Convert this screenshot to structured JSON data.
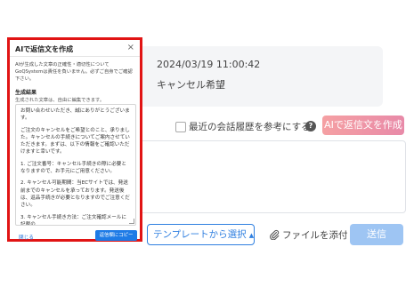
{
  "message": {
    "date": "2024/03/19 11:00:42",
    "text": "キャンセル希望"
  },
  "controls": {
    "history_checkbox_label": "最近の会話履歴を参考にする",
    "help_icon_glyph": "?",
    "ai_reply_button": "AIで返信文を作成"
  },
  "bottom_bar": {
    "template_button": "テンプレートから選択",
    "template_caret": "▲",
    "attach_label": "ファイルを添付",
    "send_button": "送信"
  },
  "dialog": {
    "title": "AIで返信文を作成",
    "close_glyph": "×",
    "notice": "AIが生成した文章の正確性・適切性について GoQSystemは責任を負いません。必ずご自身でご確認下さい。",
    "section_title": "生成結果",
    "section_sub": "生成された文章は、自由に編集できます。",
    "generated_paragraphs": [
      "お問い合わせいただき、誠にありがとうございます。",
      "ご注文のキャンセルをご希望とのこと、承りました。キャンセルの手続きについてご案内させていただきます。まずは、以下の情報をご確認いただけますと幸いです。",
      "1. ご注文番号：キャンセル手続きの際に必要となりますので、お手元にご用意ください。",
      "2. キャンセル可能期間：当ECサイトでは、発送前までのキャンセルを承っております。発送後は、返品手続きが必要となりますのでご注意ください。",
      "3. キャンセル手続き方法：ご注文確認メールに記載の"
    ],
    "close_link": "閉じる",
    "copy_button": "返信欄にコピー"
  }
}
